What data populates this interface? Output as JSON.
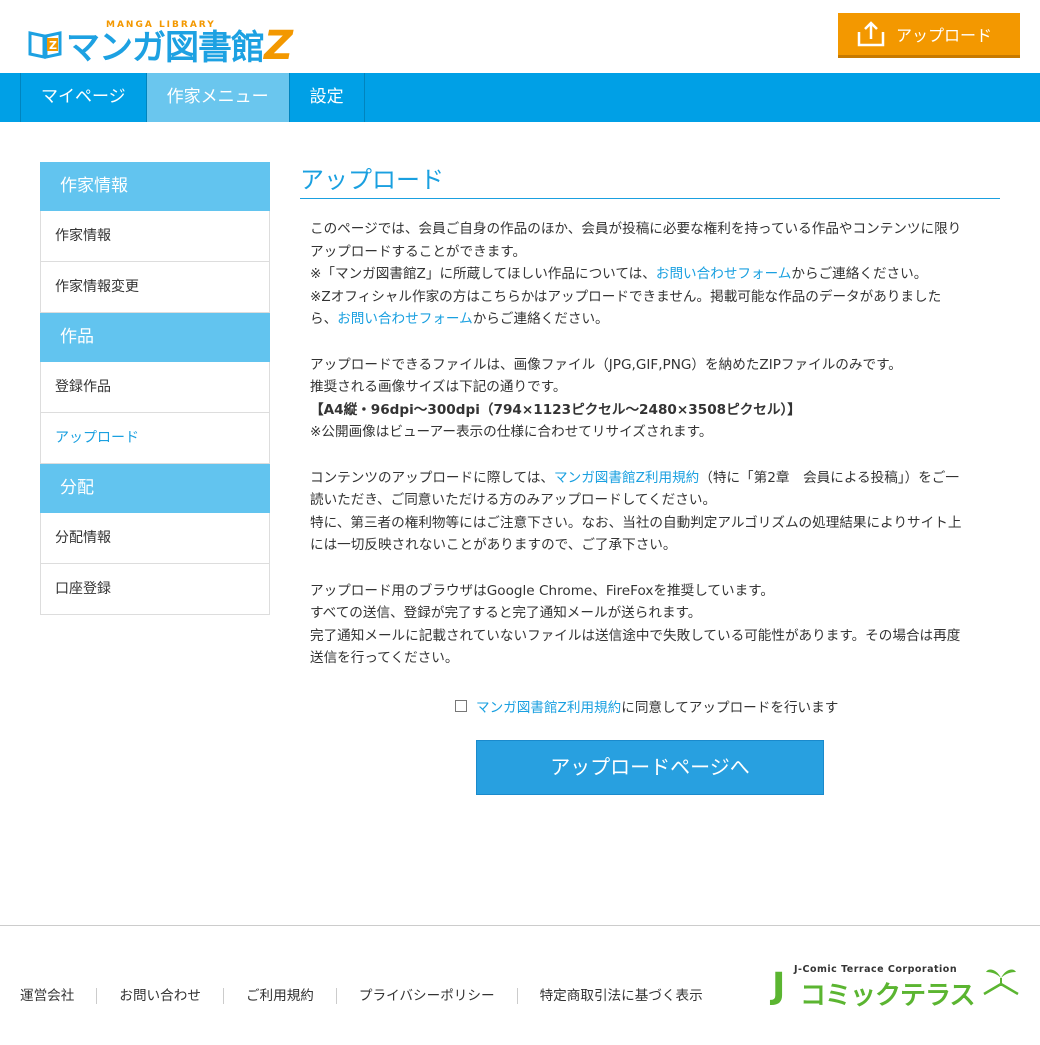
{
  "header": {
    "logo_sub": "MANGA LIBRARY",
    "logo_main": "マンガ図書館",
    "logo_z": "Z",
    "upload_label": "アップロード"
  },
  "nav": {
    "items": [
      {
        "label": "マイページ"
      },
      {
        "label": "作家メニュー"
      },
      {
        "label": "設定"
      }
    ]
  },
  "sidebar": {
    "sections": [
      {
        "heading": "作家情報",
        "items": [
          "作家情報",
          "作家情報変更"
        ]
      },
      {
        "heading": "作品",
        "items": [
          "登録作品",
          "アップロード"
        ]
      },
      {
        "heading": "分配",
        "items": [
          "分配情報",
          "口座登録"
        ]
      }
    ]
  },
  "main": {
    "title": "アップロード",
    "p1_l1": "このページでは、会員ご自身の作品のほか、会員が投稿に必要な権利を持っている作品やコンテンツに限り",
    "p1_l2": "アップロードすることができます。",
    "p1_l3a": "※「マンガ図書館Z」に所蔵してほしい作品については、",
    "p1_l3_link": "お問い合わせフォーム",
    "p1_l3b": "からご連絡ください。",
    "p1_l4": "※Zオフィシャル作家の方はこちらかはアップロードできません。掲載可能な作品のデータがありました",
    "p1_l5a": "ら、",
    "p1_l5_link": "お問い合わせフォーム",
    "p1_l5b": "からご連絡ください。",
    "p2_l1": "アップロードできるファイルは、画像ファイル（JPG,GIF,PNG）を納めたZIPファイルのみです。",
    "p2_l2": "推奨される画像サイズは下記の通りです。",
    "p2_l3": "【A4縦・96dpi～300dpi（794×1123ピクセル～2480×3508ピクセル）】",
    "p2_l4": "※公開画像はビューアー表示の仕様に合わせてリサイズされます。",
    "p3_l1a": "コンテンツのアップロードに際しては、",
    "p3_l1_link": "マンガ図書館Z利用規約",
    "p3_l1b": "（特に「第2章　会員による投稿」）をご一",
    "p3_l2": "読いただき、ご同意いただける方のみアップロードしてください。",
    "p3_l3": "特に、第三者の権利物等にはご注意下さい。なお、当社の自動判定アルゴリズムの処理結果によりサイト上",
    "p3_l4": "には一切反映されないことがありますので、ご了承下さい。",
    "p4_l1": "アップロード用のブラウザはGoogle Chrome、FireFoxを推奨しています。",
    "p4_l2": "すべての送信、登録が完了すると完了通知メールが送られます。",
    "p4_l3": "完了通知メールに記載されていないファイルは送信途中で失敗している可能性があります。その場合は再度",
    "p4_l4": "送信を行ってください。",
    "agree_link": "マンガ図書館Z利用規約",
    "agree_text": "に同意してアップロードを行います",
    "agree_checked": false,
    "go_button": "アップロードページへ"
  },
  "footer": {
    "links": [
      "運営会社",
      "お問い合わせ",
      "ご利用規約",
      "プライバシーポリシー",
      "特定商取引法に基づく表示"
    ],
    "company_sub": "J-Comic Terrace Corporation",
    "company_J": "J",
    "company_main": "コミックテラス"
  },
  "colors": {
    "brand_blue": "#00a0e6",
    "accent_orange": "#f39800",
    "link_blue": "#1aa0e0",
    "sidebar_head": "#62c4ef",
    "footer_green": "#5bb531"
  }
}
